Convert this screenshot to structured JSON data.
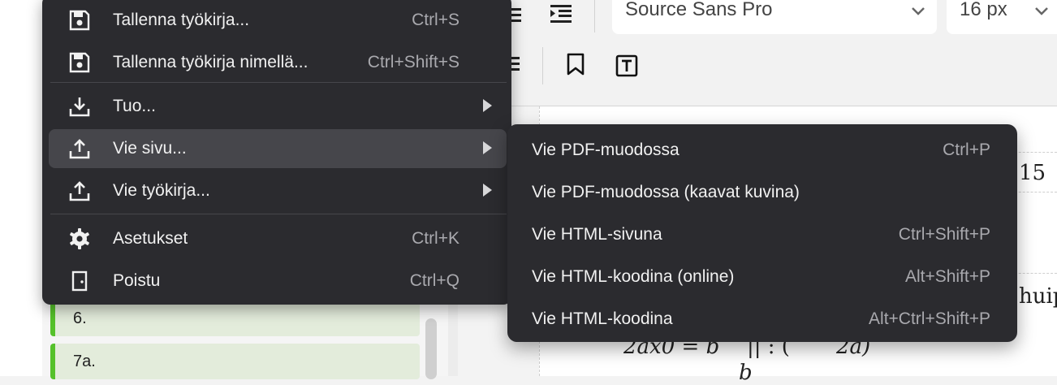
{
  "toolbar": {
    "font_family_value": "Source Sans Pro",
    "font_size_value": "16 px"
  },
  "sidebar": {
    "items": [
      {
        "label": "6."
      },
      {
        "label": "7a."
      }
    ]
  },
  "page": {
    "visible_fragments": [
      "15",
      "huip",
      "2ax0 = b",
      "|| : (",
      "2a)",
      "b"
    ]
  },
  "menu": {
    "items": [
      {
        "label": "Tallenna työkirja...",
        "shortcut": "Ctrl+S",
        "icon": "save-icon"
      },
      {
        "label": "Tallenna työkirja nimellä...",
        "shortcut": "Ctrl+Shift+S",
        "icon": "save-as-icon"
      },
      {
        "label": "Tuo...",
        "shortcut": "",
        "icon": "import-icon",
        "submenu": true
      },
      {
        "label": "Vie sivu...",
        "shortcut": "",
        "icon": "export-icon",
        "submenu": true,
        "highlighted": true
      },
      {
        "label": "Vie työkirja...",
        "shortcut": "",
        "icon": "export-icon",
        "submenu": true
      },
      {
        "label": "Asetukset",
        "shortcut": "Ctrl+K",
        "icon": "gear-icon"
      },
      {
        "label": "Poistu",
        "shortcut": "Ctrl+Q",
        "icon": "exit-door-icon"
      }
    ]
  },
  "submenu": {
    "items": [
      {
        "label": "Vie PDF-muodossa",
        "shortcut": "Ctrl+P"
      },
      {
        "label": "Vie PDF-muodossa (kaavat kuvina)",
        "shortcut": ""
      },
      {
        "label": "Vie HTML-sivuna",
        "shortcut": "Ctrl+Shift+P"
      },
      {
        "label": "Vie HTML-koodina (online)",
        "shortcut": "Alt+Shift+P"
      },
      {
        "label": "Vie HTML-koodina",
        "shortcut": "Alt+Ctrl+Shift+P"
      }
    ]
  },
  "colors": {
    "menu_bg": "#2b2b2f",
    "menu_highlight": "#46464b",
    "menu_text": "#f1f1f1",
    "shortcut_text": "#a9a9ae",
    "list_item_accent": "#55c12a",
    "list_item_bg": "#e3ecdb"
  }
}
